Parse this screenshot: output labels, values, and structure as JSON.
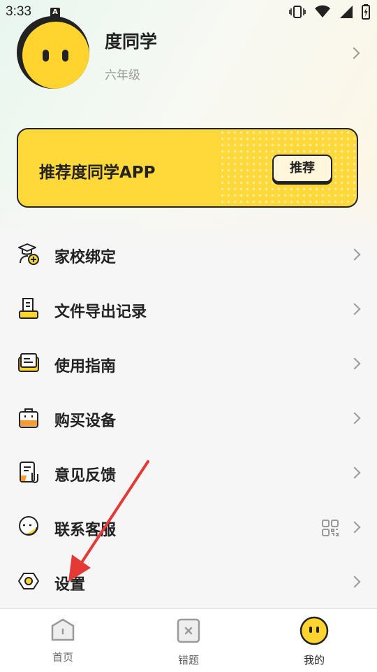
{
  "status_bar": {
    "time": "3:33",
    "notification_letter": "A"
  },
  "profile": {
    "name": "度同学",
    "grade": "六年级"
  },
  "banner": {
    "text": "推荐度同学APP",
    "button_label": "推荐"
  },
  "menu": [
    {
      "label": "家校绑定",
      "icon": "graduation-cap-add-icon"
    },
    {
      "label": "文件导出记录",
      "icon": "document-export-icon"
    },
    {
      "label": "使用指南",
      "icon": "guide-book-icon"
    },
    {
      "label": "购买设备",
      "icon": "shopping-bag-icon"
    },
    {
      "label": "意见反馈",
      "icon": "feedback-clip-icon"
    },
    {
      "label": "联系客服",
      "icon": "customer-service-icon",
      "extra_icon": "qr-code-icon"
    },
    {
      "label": "设置",
      "icon": "settings-hex-icon"
    }
  ],
  "tabs": [
    {
      "label": "首页",
      "icon": "home-icon"
    },
    {
      "label": "错题",
      "icon": "wrong-question-icon"
    },
    {
      "label": "我的",
      "icon": "mascot-face-icon",
      "active": true
    }
  ],
  "colors": {
    "brand_yellow": "#ffd83a",
    "annotation_red": "#e53935",
    "text_dark": "#222222"
  }
}
